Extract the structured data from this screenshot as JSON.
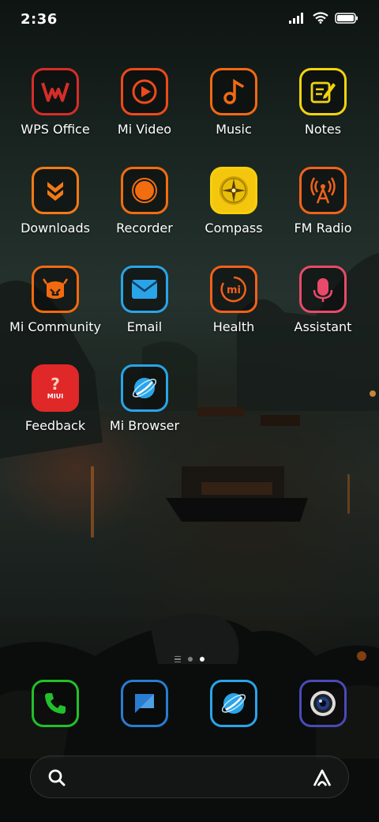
{
  "status_bar": {
    "time": "2:36",
    "icons": [
      "signal-icon",
      "wifi-icon",
      "battery-icon"
    ]
  },
  "apps": [
    {
      "label": "WPS Office",
      "icon": "wps-office-icon",
      "color": "#d52d28"
    },
    {
      "label": "Mi Video",
      "icon": "mi-video-icon",
      "color": "#ee4a1a"
    },
    {
      "label": "Music",
      "icon": "music-icon",
      "color": "#f26a12"
    },
    {
      "label": "Notes",
      "icon": "notes-icon",
      "color": "#f2d40d"
    },
    {
      "label": "Downloads",
      "icon": "downloads-icon",
      "color": "#f27a14"
    },
    {
      "label": "Recorder",
      "icon": "recorder-icon",
      "color": "#f26d10"
    },
    {
      "label": "Compass",
      "icon": "compass-icon",
      "color": "#f7d00c"
    },
    {
      "label": "FM Radio",
      "icon": "fm-radio-icon",
      "color": "#f2621a"
    },
    {
      "label": "Mi Community",
      "icon": "mi-community-icon",
      "color": "#f26a10"
    },
    {
      "label": "Email",
      "icon": "email-icon",
      "color": "#2aa4e8"
    },
    {
      "label": "Health",
      "icon": "health-icon",
      "color": "#f2601a"
    },
    {
      "label": "Assistant",
      "icon": "assistant-icon",
      "color": "#e84a6a"
    },
    {
      "label": "Feedback",
      "icon": "feedback-icon",
      "color": "#e02828",
      "badge": "MIUI",
      "mark": "?"
    },
    {
      "label": "Mi Browser",
      "icon": "mi-browser-icon",
      "color": "#2aa4e8"
    }
  ],
  "health_icon_text": "mi",
  "page_indicator": {
    "pages": 2,
    "current": 2
  },
  "dock": [
    {
      "icon": "phone-icon",
      "color": "#22c02a"
    },
    {
      "icon": "messages-icon",
      "color": "#2a7cd0"
    },
    {
      "icon": "browser-icon",
      "color": "#2aa4e8"
    },
    {
      "icon": "camera-icon",
      "color": "#4a4ab8"
    }
  ],
  "search": {
    "left_icon": "search-icon",
    "right_icon": "assistant-a-icon"
  }
}
